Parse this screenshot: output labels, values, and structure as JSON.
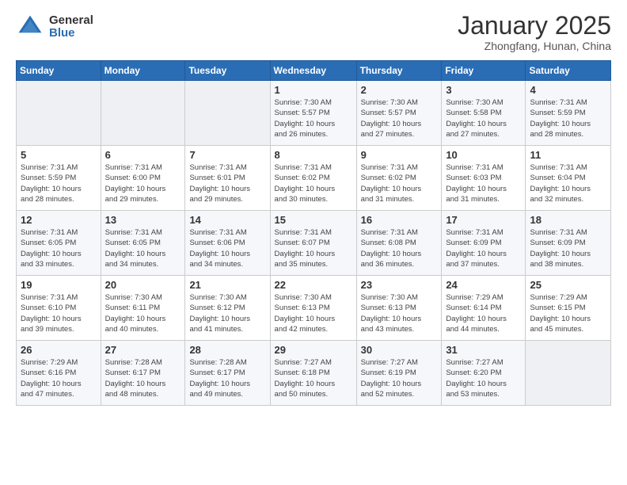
{
  "header": {
    "logo_general": "General",
    "logo_blue": "Blue",
    "title": "January 2025",
    "subtitle": "Zhongfang, Hunan, China"
  },
  "days_of_week": [
    "Sunday",
    "Monday",
    "Tuesday",
    "Wednesday",
    "Thursday",
    "Friday",
    "Saturday"
  ],
  "weeks": [
    [
      {
        "day": "",
        "info": ""
      },
      {
        "day": "",
        "info": ""
      },
      {
        "day": "",
        "info": ""
      },
      {
        "day": "1",
        "info": "Sunrise: 7:30 AM\nSunset: 5:57 PM\nDaylight: 10 hours\nand 26 minutes."
      },
      {
        "day": "2",
        "info": "Sunrise: 7:30 AM\nSunset: 5:57 PM\nDaylight: 10 hours\nand 27 minutes."
      },
      {
        "day": "3",
        "info": "Sunrise: 7:30 AM\nSunset: 5:58 PM\nDaylight: 10 hours\nand 27 minutes."
      },
      {
        "day": "4",
        "info": "Sunrise: 7:31 AM\nSunset: 5:59 PM\nDaylight: 10 hours\nand 28 minutes."
      }
    ],
    [
      {
        "day": "5",
        "info": "Sunrise: 7:31 AM\nSunset: 5:59 PM\nDaylight: 10 hours\nand 28 minutes."
      },
      {
        "day": "6",
        "info": "Sunrise: 7:31 AM\nSunset: 6:00 PM\nDaylight: 10 hours\nand 29 minutes."
      },
      {
        "day": "7",
        "info": "Sunrise: 7:31 AM\nSunset: 6:01 PM\nDaylight: 10 hours\nand 29 minutes."
      },
      {
        "day": "8",
        "info": "Sunrise: 7:31 AM\nSunset: 6:02 PM\nDaylight: 10 hours\nand 30 minutes."
      },
      {
        "day": "9",
        "info": "Sunrise: 7:31 AM\nSunset: 6:02 PM\nDaylight: 10 hours\nand 31 minutes."
      },
      {
        "day": "10",
        "info": "Sunrise: 7:31 AM\nSunset: 6:03 PM\nDaylight: 10 hours\nand 31 minutes."
      },
      {
        "day": "11",
        "info": "Sunrise: 7:31 AM\nSunset: 6:04 PM\nDaylight: 10 hours\nand 32 minutes."
      }
    ],
    [
      {
        "day": "12",
        "info": "Sunrise: 7:31 AM\nSunset: 6:05 PM\nDaylight: 10 hours\nand 33 minutes."
      },
      {
        "day": "13",
        "info": "Sunrise: 7:31 AM\nSunset: 6:05 PM\nDaylight: 10 hours\nand 34 minutes."
      },
      {
        "day": "14",
        "info": "Sunrise: 7:31 AM\nSunset: 6:06 PM\nDaylight: 10 hours\nand 34 minutes."
      },
      {
        "day": "15",
        "info": "Sunrise: 7:31 AM\nSunset: 6:07 PM\nDaylight: 10 hours\nand 35 minutes."
      },
      {
        "day": "16",
        "info": "Sunrise: 7:31 AM\nSunset: 6:08 PM\nDaylight: 10 hours\nand 36 minutes."
      },
      {
        "day": "17",
        "info": "Sunrise: 7:31 AM\nSunset: 6:09 PM\nDaylight: 10 hours\nand 37 minutes."
      },
      {
        "day": "18",
        "info": "Sunrise: 7:31 AM\nSunset: 6:09 PM\nDaylight: 10 hours\nand 38 minutes."
      }
    ],
    [
      {
        "day": "19",
        "info": "Sunrise: 7:31 AM\nSunset: 6:10 PM\nDaylight: 10 hours\nand 39 minutes."
      },
      {
        "day": "20",
        "info": "Sunrise: 7:30 AM\nSunset: 6:11 PM\nDaylight: 10 hours\nand 40 minutes."
      },
      {
        "day": "21",
        "info": "Sunrise: 7:30 AM\nSunset: 6:12 PM\nDaylight: 10 hours\nand 41 minutes."
      },
      {
        "day": "22",
        "info": "Sunrise: 7:30 AM\nSunset: 6:13 PM\nDaylight: 10 hours\nand 42 minutes."
      },
      {
        "day": "23",
        "info": "Sunrise: 7:30 AM\nSunset: 6:13 PM\nDaylight: 10 hours\nand 43 minutes."
      },
      {
        "day": "24",
        "info": "Sunrise: 7:29 AM\nSunset: 6:14 PM\nDaylight: 10 hours\nand 44 minutes."
      },
      {
        "day": "25",
        "info": "Sunrise: 7:29 AM\nSunset: 6:15 PM\nDaylight: 10 hours\nand 45 minutes."
      }
    ],
    [
      {
        "day": "26",
        "info": "Sunrise: 7:29 AM\nSunset: 6:16 PM\nDaylight: 10 hours\nand 47 minutes."
      },
      {
        "day": "27",
        "info": "Sunrise: 7:28 AM\nSunset: 6:17 PM\nDaylight: 10 hours\nand 48 minutes."
      },
      {
        "day": "28",
        "info": "Sunrise: 7:28 AM\nSunset: 6:17 PM\nDaylight: 10 hours\nand 49 minutes."
      },
      {
        "day": "29",
        "info": "Sunrise: 7:27 AM\nSunset: 6:18 PM\nDaylight: 10 hours\nand 50 minutes."
      },
      {
        "day": "30",
        "info": "Sunrise: 7:27 AM\nSunset: 6:19 PM\nDaylight: 10 hours\nand 52 minutes."
      },
      {
        "day": "31",
        "info": "Sunrise: 7:27 AM\nSunset: 6:20 PM\nDaylight: 10 hours\nand 53 minutes."
      },
      {
        "day": "",
        "info": ""
      }
    ]
  ]
}
